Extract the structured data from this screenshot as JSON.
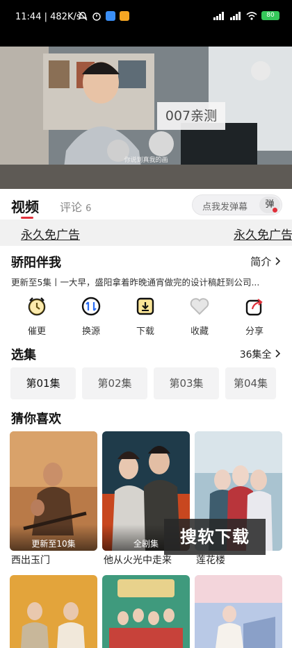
{
  "status_bar": {
    "time": "11:44",
    "net_speed": "482K/s",
    "battery": "80"
  },
  "video": {
    "overlay_text": "007亲测",
    "subtitle": "你说到真我的画"
  },
  "tabs": {
    "video_label": "视频",
    "comment_label": "评论",
    "comment_count": "6"
  },
  "danmaku": {
    "placeholder": "点我发弹幕",
    "button_label": "弹"
  },
  "ad": {
    "left_text": "永久免广告",
    "right_text": "永久免广告"
  },
  "show": {
    "title": "骄阳伴我",
    "intro_label": "简介",
    "description": "更新至5集丨一大早，盛阳拿着昨晚通宵做完的设计稿赶到公司..."
  },
  "actions": [
    {
      "label": "催更",
      "icon": "alarm-clock-icon"
    },
    {
      "label": "换源",
      "icon": "switch-source-icon"
    },
    {
      "label": "下载",
      "icon": "download-icon"
    },
    {
      "label": "收藏",
      "icon": "heart-icon"
    },
    {
      "label": "分享",
      "icon": "share-icon"
    }
  ],
  "episodes": {
    "title": "选集",
    "count_label": "36集全",
    "items": [
      "第01集",
      "第02集",
      "第03集",
      "第04集"
    ]
  },
  "recommend": {
    "title": "猜你喜欢",
    "items": [
      {
        "name": "西出玉门",
        "badge": "更新至10集"
      },
      {
        "name": "他从火光中走来",
        "badge": "全剧集"
      },
      {
        "name": "莲花楼",
        "badge": ""
      }
    ]
  },
  "watermark": "搜软下载",
  "colors": {
    "accent": "#e0303a",
    "battery": "#35c75a"
  }
}
